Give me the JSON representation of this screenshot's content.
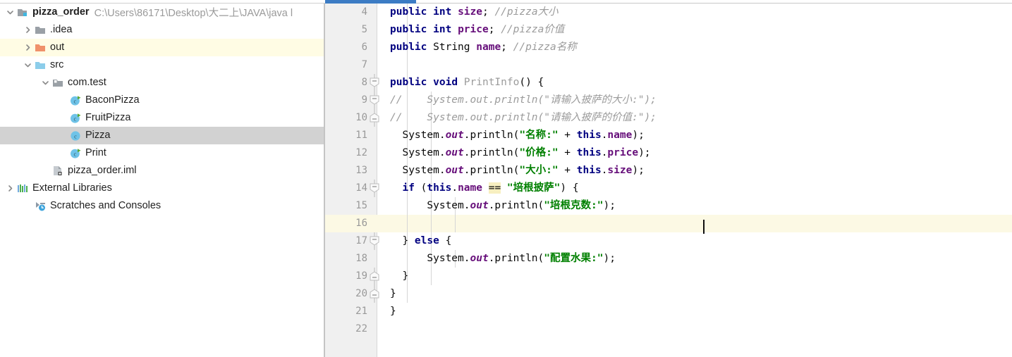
{
  "window": {
    "accent_color": "#3C7CC4",
    "selection_color": "#D2D2D2",
    "highlight_color": "#FFFCE4",
    "caret_line_color": "#FCF9E4"
  },
  "project_tree": {
    "name": "project-tree",
    "items": [
      {
        "label": "pizza_order",
        "path": "C:\\Users\\86171\\Desktop\\大二上\\JAVA\\java l",
        "icon": "module-icon",
        "depth": 0,
        "arrow": "expanded",
        "state": "none",
        "bold": true
      },
      {
        "label": ".idea",
        "path": "",
        "icon": "folder-gray-icon",
        "depth": 1,
        "arrow": "collapsed",
        "state": "none",
        "bold": false
      },
      {
        "label": "out",
        "path": "",
        "icon": "folder-orange-icon",
        "depth": 1,
        "arrow": "collapsed",
        "state": "highlight",
        "bold": false
      },
      {
        "label": "src",
        "path": "",
        "icon": "folder-blue-icon",
        "depth": 1,
        "arrow": "expanded",
        "state": "none",
        "bold": false
      },
      {
        "label": "com.test",
        "path": "",
        "icon": "package-icon",
        "depth": 2,
        "arrow": "expanded",
        "state": "none",
        "bold": false
      },
      {
        "label": "BaconPizza",
        "path": "",
        "icon": "class-run-icon",
        "depth": 3,
        "arrow": "none",
        "state": "none",
        "bold": false
      },
      {
        "label": "FruitPizza",
        "path": "",
        "icon": "class-run-icon",
        "depth": 3,
        "arrow": "none",
        "state": "none",
        "bold": false
      },
      {
        "label": "Pizza",
        "path": "",
        "icon": "class-icon",
        "depth": 3,
        "arrow": "none",
        "state": "selected",
        "bold": false
      },
      {
        "label": "Print",
        "path": "",
        "icon": "class-run-icon",
        "depth": 3,
        "arrow": "none",
        "state": "none",
        "bold": false
      },
      {
        "label": "pizza_order.iml",
        "path": "",
        "icon": "iml-file-icon",
        "depth": 2,
        "arrow": "none",
        "state": "none",
        "bold": false
      },
      {
        "label": "External Libraries",
        "path": "",
        "icon": "libraries-icon",
        "depth": 0,
        "arrow": "collapsed",
        "state": "none",
        "bold": false
      },
      {
        "label": "Scratches and Consoles",
        "path": "",
        "icon": "scratches-icon",
        "depth": 1,
        "arrow": "none",
        "state": "none",
        "bold": false
      }
    ]
  },
  "editor": {
    "name": "code-editor",
    "caret_line": 16,
    "first_visible_line": 4,
    "lines": [
      {
        "num": "4",
        "fold": "none",
        "indent_guides": 1,
        "tokens": [
          {
            "t": "public",
            "c": "kw"
          },
          {
            "t": " ",
            "c": "plain"
          },
          {
            "t": "int",
            "c": "kw"
          },
          {
            "t": " ",
            "c": "plain"
          },
          {
            "t": "size",
            "c": "fld"
          },
          {
            "t": "; ",
            "c": "plain"
          },
          {
            "t": "//pizza大小",
            "c": "cmt"
          }
        ]
      },
      {
        "num": "5",
        "fold": "none",
        "indent_guides": 1,
        "tokens": [
          {
            "t": "public",
            "c": "kw"
          },
          {
            "t": " ",
            "c": "plain"
          },
          {
            "t": "int",
            "c": "kw"
          },
          {
            "t": " ",
            "c": "plain"
          },
          {
            "t": "price",
            "c": "fld"
          },
          {
            "t": "; ",
            "c": "plain"
          },
          {
            "t": "//pizza价值",
            "c": "cmt"
          }
        ]
      },
      {
        "num": "6",
        "fold": "none",
        "indent_guides": 1,
        "tokens": [
          {
            "t": "public",
            "c": "kw"
          },
          {
            "t": " ",
            "c": "plain"
          },
          {
            "t": "String",
            "c": "plain"
          },
          {
            "t": " ",
            "c": "plain"
          },
          {
            "t": "name",
            "c": "fld"
          },
          {
            "t": "; ",
            "c": "plain"
          },
          {
            "t": "//pizza名称",
            "c": "cmt"
          }
        ]
      },
      {
        "num": "7",
        "fold": "none",
        "indent_guides": 1,
        "tokens": []
      },
      {
        "num": "8",
        "fold": "start",
        "indent_guides": 1,
        "tokens": [
          {
            "t": "public",
            "c": "kw"
          },
          {
            "t": " ",
            "c": "plain"
          },
          {
            "t": "void",
            "c": "kw"
          },
          {
            "t": " ",
            "c": "plain"
          },
          {
            "t": "PrintInfo",
            "c": "gray"
          },
          {
            "t": "() {",
            "c": "brace"
          }
        ]
      },
      {
        "num": "9",
        "fold": "mid",
        "indent_guides": 2,
        "comment_prefix": "//",
        "tokens": [
          {
            "t": "    System.out.println(\"请输入披萨的大小:\");",
            "c": "cmt"
          }
        ]
      },
      {
        "num": "10",
        "fold": "end",
        "indent_guides": 2,
        "comment_prefix": "//",
        "tokens": [
          {
            "t": "    System.out.println(\"请输入披萨的价值:\");",
            "c": "cmt"
          }
        ]
      },
      {
        "num": "11",
        "fold": "none",
        "indent_guides": 2,
        "tokens": [
          {
            "t": "  System.",
            "c": "plain"
          },
          {
            "t": "out",
            "c": "stat"
          },
          {
            "t": ".println(",
            "c": "plain"
          },
          {
            "t": "\"名称:\"",
            "c": "str"
          },
          {
            "t": " + ",
            "c": "plain"
          },
          {
            "t": "this",
            "c": "kw"
          },
          {
            "t": ".",
            "c": "plain"
          },
          {
            "t": "name",
            "c": "fld"
          },
          {
            "t": ");",
            "c": "plain"
          }
        ]
      },
      {
        "num": "12",
        "fold": "none",
        "indent_guides": 2,
        "tokens": [
          {
            "t": "  System.",
            "c": "plain"
          },
          {
            "t": "out",
            "c": "stat"
          },
          {
            "t": ".println(",
            "c": "plain"
          },
          {
            "t": "\"价格:\"",
            "c": "str"
          },
          {
            "t": " + ",
            "c": "plain"
          },
          {
            "t": "this",
            "c": "kw"
          },
          {
            "t": ".",
            "c": "plain"
          },
          {
            "t": "price",
            "c": "fld"
          },
          {
            "t": ");",
            "c": "plain"
          }
        ]
      },
      {
        "num": "13",
        "fold": "none",
        "indent_guides": 2,
        "tokens": [
          {
            "t": "  System.",
            "c": "plain"
          },
          {
            "t": "out",
            "c": "stat"
          },
          {
            "t": ".println(",
            "c": "plain"
          },
          {
            "t": "\"大小:\"",
            "c": "str"
          },
          {
            "t": " + ",
            "c": "plain"
          },
          {
            "t": "this",
            "c": "kw"
          },
          {
            "t": ".",
            "c": "plain"
          },
          {
            "t": "size",
            "c": "fld"
          },
          {
            "t": ");",
            "c": "plain"
          }
        ]
      },
      {
        "num": "14",
        "fold": "start",
        "indent_guides": 2,
        "tokens": [
          {
            "t": "  ",
            "c": "plain"
          },
          {
            "t": "if",
            "c": "kw"
          },
          {
            "t": " (",
            "c": "plain"
          },
          {
            "t": "this",
            "c": "kw"
          },
          {
            "t": ".",
            "c": "plain"
          },
          {
            "t": "name",
            "c": "fld"
          },
          {
            "t": " ",
            "c": "plain"
          },
          {
            "t": "==",
            "c": "plain hl"
          },
          {
            "t": " ",
            "c": "plain"
          },
          {
            "t": "\"培根披萨\"",
            "c": "str"
          },
          {
            "t": ") {",
            "c": "brace"
          }
        ]
      },
      {
        "num": "15",
        "fold": "none",
        "indent_guides": 3,
        "tokens": [
          {
            "t": "      System.",
            "c": "plain"
          },
          {
            "t": "out",
            "c": "stat"
          },
          {
            "t": ".println(",
            "c": "plain"
          },
          {
            "t": "\"培根克数:\"",
            "c": "str"
          },
          {
            "t": ");",
            "c": "plain"
          }
        ]
      },
      {
        "num": "16",
        "fold": "none",
        "indent_guides": 3,
        "tokens": []
      },
      {
        "num": "17",
        "fold": "start",
        "indent_guides": 2,
        "tokens": [
          {
            "t": "  } ",
            "c": "brace"
          },
          {
            "t": "else",
            "c": "kw"
          },
          {
            "t": " {",
            "c": "brace"
          }
        ]
      },
      {
        "num": "18",
        "fold": "none",
        "indent_guides": 3,
        "tokens": [
          {
            "t": "      System.",
            "c": "plain"
          },
          {
            "t": "out",
            "c": "stat"
          },
          {
            "t": ".println(",
            "c": "plain"
          },
          {
            "t": "\"配置水果:\"",
            "c": "str"
          },
          {
            "t": ");",
            "c": "plain"
          }
        ]
      },
      {
        "num": "19",
        "fold": "end",
        "indent_guides": 2,
        "tokens": [
          {
            "t": "  }",
            "c": "brace"
          }
        ]
      },
      {
        "num": "20",
        "fold": "end",
        "indent_guides": 1,
        "tokens": [
          {
            "t": "}",
            "c": "brace"
          }
        ]
      },
      {
        "num": "21",
        "fold": "none",
        "indent_guides": 0,
        "tokens": [
          {
            "t": "}",
            "c": "brace"
          }
        ]
      },
      {
        "num": "22",
        "fold": "none",
        "indent_guides": 0,
        "tokens": []
      }
    ]
  }
}
